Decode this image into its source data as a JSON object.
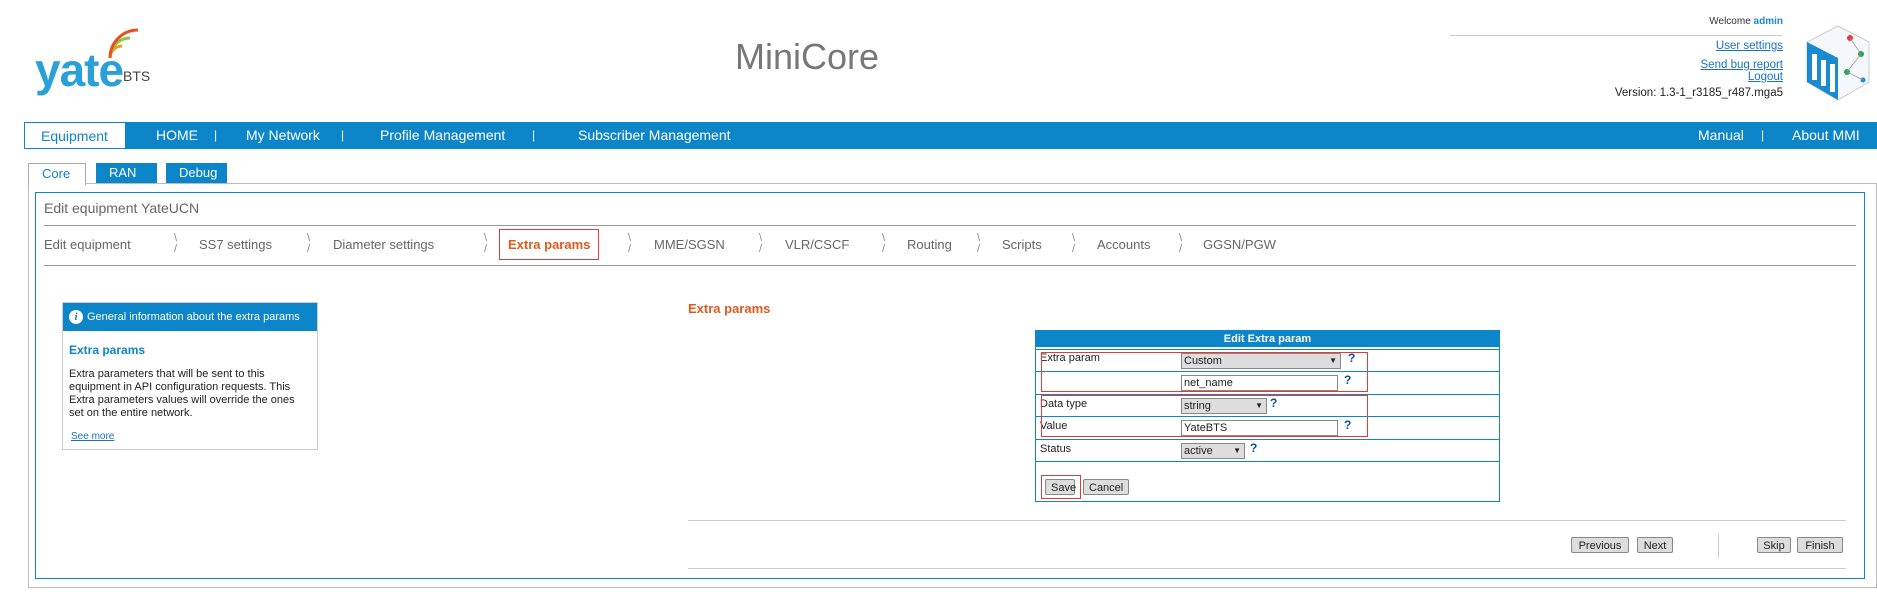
{
  "header": {
    "logo_text": "yate",
    "logo_sub": "BTS",
    "app_title": "MiniCore",
    "welcome_prefix": "Welcome",
    "welcome_user": "admin",
    "links": [
      "User settings",
      "Send bug report",
      "Logout"
    ],
    "version": "Version: 1.3-1_r3185_r487.mga5"
  },
  "nav": {
    "left": [
      "Equipment",
      "HOME",
      "My Network",
      "Profile Management",
      "Subscriber Management"
    ],
    "right": [
      "Manual",
      "About MMI"
    ],
    "sep": "|"
  },
  "subtabs": [
    "Core",
    "RAN",
    "Debug"
  ],
  "panel": {
    "title": "Edit equipment YateUCN",
    "steps": [
      "Edit equipment",
      "SS7 settings",
      "Diameter settings",
      "Extra params",
      "MME/SGSN",
      "VLR/CSCF",
      "Routing",
      "Scripts",
      "Accounts",
      "GGSN/PGW"
    ]
  },
  "info": {
    "header": "General information about the extra params",
    "title": "Extra params",
    "text": "Extra parameters that will be sent to this equipment in API configuration requests. This Extra parameters values will override the ones set on the entire network.",
    "more": "See more"
  },
  "form": {
    "section_title": "Extra params",
    "header": "Edit Extra param",
    "extra_param_label": "Extra param",
    "extra_param_value": "Custom",
    "custom_name": "net_name",
    "data_type_label": "Data type",
    "data_type_value": "string",
    "value_label": "Value",
    "value_value": "YateBTS",
    "status_label": "Status",
    "status_value": "active",
    "save": "Save",
    "cancel": "Cancel",
    "help": "?"
  },
  "wizard": {
    "previous": "Previous",
    "next": "Next",
    "skip": "Skip",
    "finish": "Finish"
  },
  "colors": {
    "accent": "#0d85c9",
    "highlight": "#e05a1e",
    "marker": "#e53a3a"
  }
}
